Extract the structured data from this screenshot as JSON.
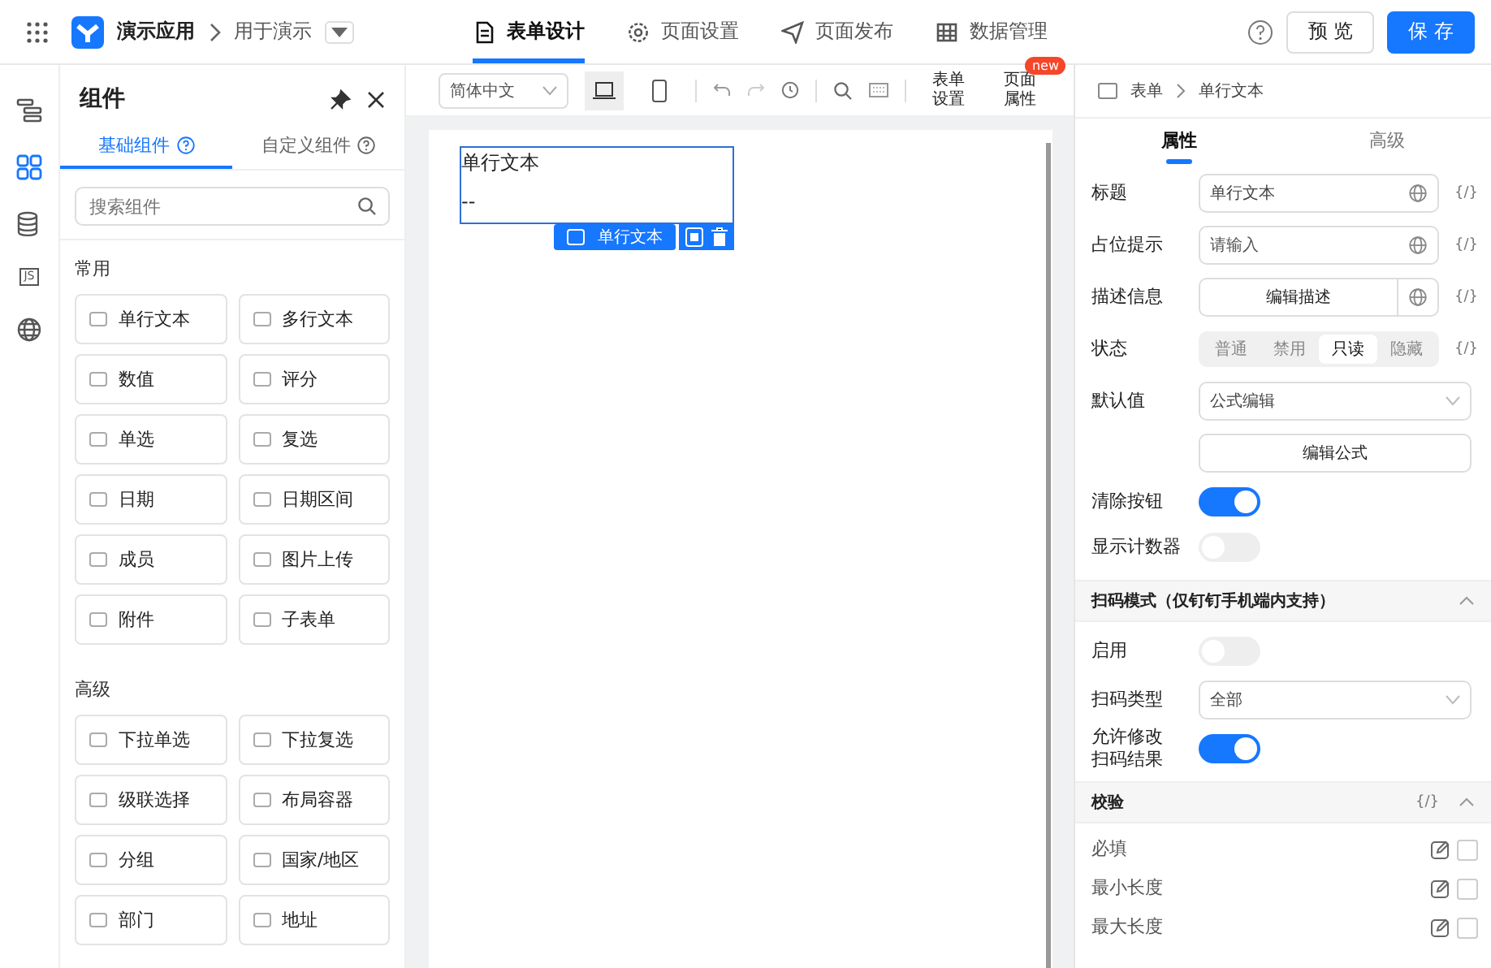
{
  "topbar": {
    "app_name": "演示应用",
    "page_name": "用于演示",
    "nav": [
      {
        "label": "表单设计",
        "selected": true,
        "kind": "doc"
      },
      {
        "label": "页面设置",
        "selected": false,
        "kind": "gear"
      },
      {
        "label": "页面发布",
        "selected": false,
        "kind": "send"
      },
      {
        "label": "数据管理",
        "selected": false,
        "kind": "table"
      }
    ],
    "buttons": [
      {
        "label": "预 览",
        "kind": "secondary"
      },
      {
        "label": "保 存",
        "kind": "primary"
      }
    ]
  },
  "rail": {
    "items": [
      {
        "kind": "outline",
        "selected": false
      },
      {
        "kind": "components",
        "selected": true
      },
      {
        "kind": "database",
        "selected": false
      },
      {
        "kind": "js",
        "label": "JS",
        "selected": false
      },
      {
        "kind": "globe",
        "selected": false
      }
    ]
  },
  "components_panel": {
    "title": "组件",
    "tabs": [
      {
        "label": "基础组件",
        "selected": true
      },
      {
        "label": "自定义组件",
        "selected": false
      }
    ],
    "search": {
      "placeholder": "搜索组件"
    },
    "groups": [
      {
        "title": "常用",
        "items": [
          "单行文本",
          "多行文本",
          "数值",
          "评分",
          "单选",
          "复选",
          "日期",
          "日期区间",
          "成员",
          "图片上传",
          "附件",
          "子表单"
        ]
      },
      {
        "title": "高级",
        "items": [
          "下拉单选",
          "下拉复选",
          "级联选择",
          "布局容器",
          "分组",
          "国家/地区",
          "部门",
          "地址"
        ]
      }
    ]
  },
  "canvas_toolbar": {
    "language": "简体中文",
    "devices": [
      {
        "kind": "desktop",
        "selected": true
      },
      {
        "kind": "mobile",
        "selected": false
      }
    ],
    "links": [
      {
        "label": "表单设置"
      },
      {
        "label": "页面属性",
        "badge": "new"
      }
    ]
  },
  "canvas": {
    "field": {
      "label": "单行文本",
      "value": "--",
      "tag": "单行文本",
      "selected": true
    }
  },
  "properties": {
    "breadcrumb": [
      "表单",
      "单行文本"
    ],
    "tabs": [
      {
        "label": "属性",
        "selected": true
      },
      {
        "label": "高级",
        "selected": false
      }
    ],
    "rows": [
      {
        "kind": "input",
        "label": "标题",
        "value": "单行文本",
        "expr": "{/}"
      },
      {
        "kind": "input",
        "label": "占位提示",
        "placeholder": "请输入",
        "expr": "{/}"
      },
      {
        "kind": "action",
        "label": "描述信息",
        "button": "编辑描述",
        "globe": true,
        "expr": "{/}"
      },
      {
        "kind": "segmented",
        "label": "状态",
        "options": [
          {
            "label": "普通",
            "selected": false
          },
          {
            "label": "禁用",
            "selected": false
          },
          {
            "label": "只读",
            "selected": true
          },
          {
            "label": "隐藏",
            "selected": false
          }
        ],
        "expr": "{/}"
      },
      {
        "kind": "select",
        "label": "默认值",
        "value": "公式编辑"
      },
      {
        "kind": "action",
        "button": "编辑公式",
        "globe": false
      },
      {
        "kind": "switch",
        "label": "清除按钮",
        "on": true
      },
      {
        "kind": "switch",
        "label": "显示计数器",
        "on": false
      },
      {
        "kind": "section",
        "title": "扫码模式（仅钉钉手机端内支持）",
        "expanded": true
      },
      {
        "kind": "switch",
        "label": "启用",
        "on": false
      },
      {
        "kind": "select",
        "label": "扫码类型",
        "value": "全部"
      },
      {
        "kind": "switch",
        "label": "允许修改扫码结果",
        "narrow_label": true,
        "on": true
      },
      {
        "kind": "section",
        "title": "校验",
        "expr": "{/}",
        "expanded": true
      },
      {
        "kind": "check",
        "label": "必填",
        "checked": false
      },
      {
        "kind": "check",
        "label": "最小长度",
        "checked": false
      },
      {
        "kind": "check",
        "label": "最大长度",
        "checked": false
      }
    ]
  }
}
